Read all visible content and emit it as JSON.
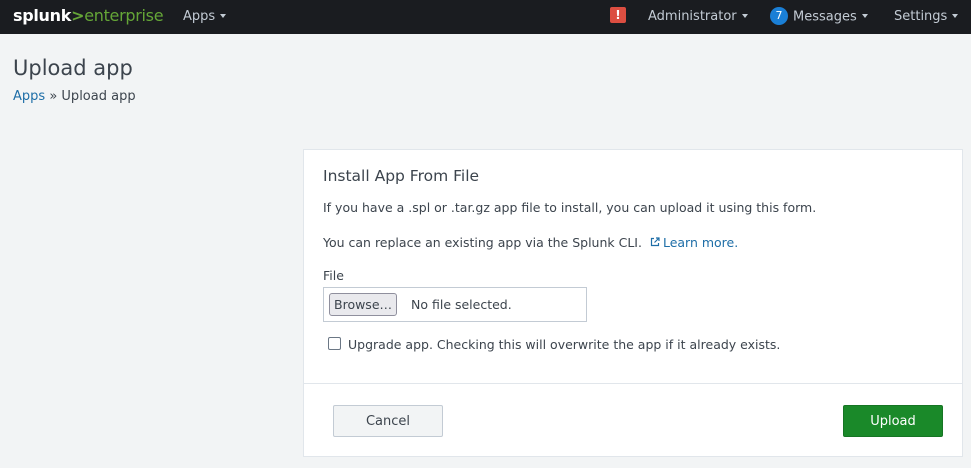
{
  "topbar": {
    "logo": {
      "brand": "splunk",
      "separator": ">",
      "product": "enterprise"
    },
    "apps_label": "Apps",
    "alert_icon_glyph": "!",
    "user_label": "Administrator",
    "messages_count": "7",
    "messages_label": "Messages",
    "settings_label": "Settings",
    "icons": {
      "alert": "exclamation-alert-icon",
      "dropdown": "caret-down-icon"
    },
    "colors": {
      "background": "#1a1c20",
      "brand_accent": "#65a637",
      "alert": "#dc4e41",
      "badge": "#1a7fd6"
    }
  },
  "page": {
    "title": "Upload app",
    "breadcrumb": {
      "parent_label": "Apps",
      "separator": "»",
      "current_label": "Upload app"
    }
  },
  "panel": {
    "title": "Install App From File",
    "description": "If you have a .spl or .tar.gz app file to install, you can upload it using this form.",
    "cli_text": "You can replace an existing app via the Splunk CLI.",
    "learn_more_label": "Learn more.",
    "learn_more_icon": "external-link-icon",
    "file_label": "File",
    "browse_label": "Browse…",
    "file_status": "No file selected.",
    "upgrade_checked": false,
    "upgrade_label": "Upgrade app. Checking this will overwrite the app if it already exists.",
    "cancel_label": "Cancel",
    "upload_label": "Upload",
    "colors": {
      "link": "#1e6ea7",
      "primary_button": "#1a8929"
    }
  }
}
